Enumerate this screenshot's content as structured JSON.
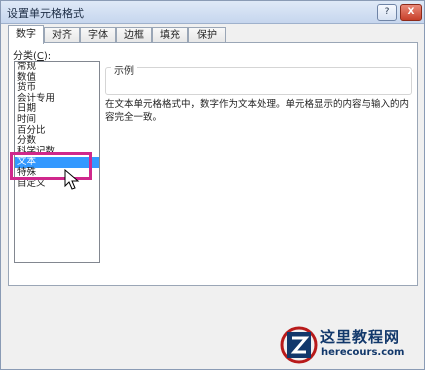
{
  "window": {
    "title": "设置单元格格式",
    "help_glyph": "?",
    "close_glyph": "X"
  },
  "tabs": [
    {
      "label": "数字",
      "active": true
    },
    {
      "label": "对齐",
      "active": false
    },
    {
      "label": "字体",
      "active": false
    },
    {
      "label": "边框",
      "active": false
    },
    {
      "label": "填充",
      "active": false
    },
    {
      "label": "保护",
      "active": false
    }
  ],
  "category": {
    "label": "分类(",
    "accelerator": "C",
    "label_suffix": "):",
    "items": [
      {
        "label": "常规"
      },
      {
        "label": "数值"
      },
      {
        "label": "货币"
      },
      {
        "label": "会计专用"
      },
      {
        "label": "日期"
      },
      {
        "label": "时间"
      },
      {
        "label": "百分比"
      },
      {
        "label": "分数"
      },
      {
        "label": "科学记数"
      },
      {
        "label": "文本",
        "selected": true
      },
      {
        "label": "特殊"
      },
      {
        "label": "自定义"
      }
    ]
  },
  "sample": {
    "label": "示例",
    "value": ""
  },
  "description": "在文本单元格格式中，数字作为文本处理。单元格显示的内容与输入的内容完全一致。",
  "watermark": {
    "title": "这里教程网",
    "url": "herecours.com"
  },
  "colors": {
    "selection": "#3399ff",
    "highlight_box": "#d0288c"
  }
}
